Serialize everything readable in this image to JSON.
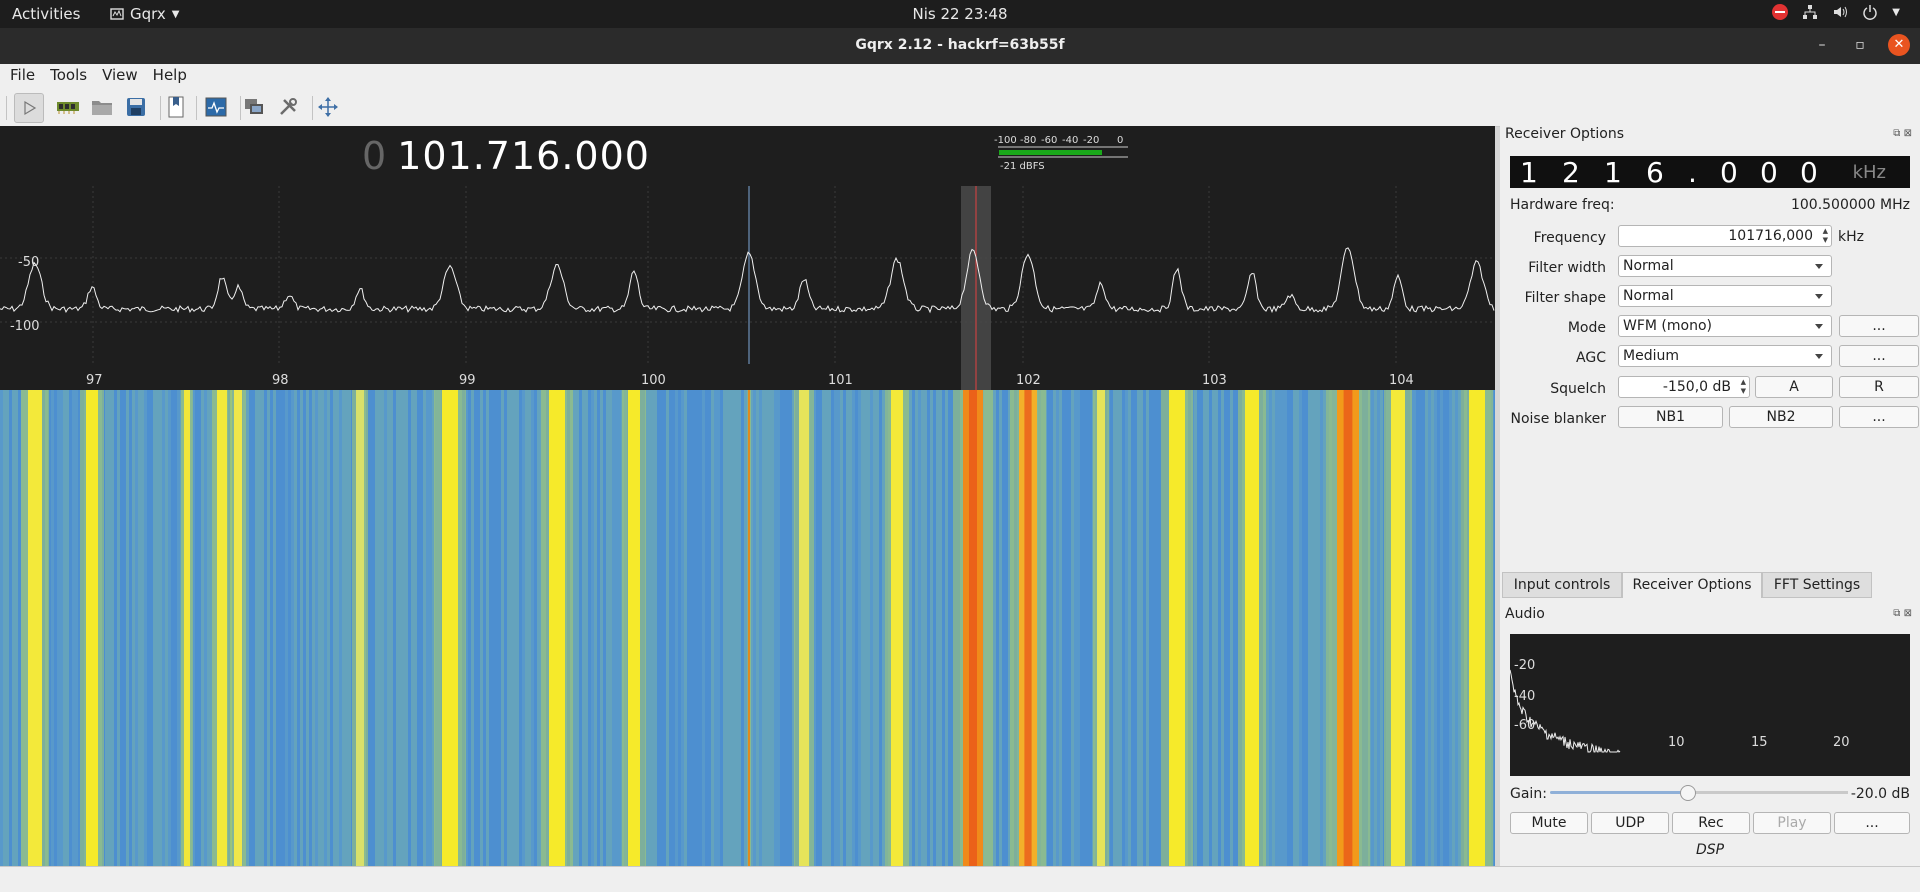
{
  "topbar": {
    "activities": "Activities",
    "app_name": "Gqrx",
    "clock": "Nis 22  23:48"
  },
  "window": {
    "title": "Gqrx 2.12 - hackrf=63b55f"
  },
  "menu": {
    "file": "File",
    "tools": "Tools",
    "view": "View",
    "help": "Help"
  },
  "display": {
    "freq_lead": "0",
    "freq": "101.716.000",
    "meter_scale": [
      "-100",
      "-80",
      "-60",
      "-40",
      "-20",
      "0"
    ],
    "meter_level_label": "-21 dBFS",
    "meter_level_dbfs": -21,
    "y_ticks": [
      "-50",
      "-100"
    ],
    "x_ticks": [
      "97",
      "98",
      "99",
      "100",
      "101",
      "102",
      "103",
      "104"
    ]
  },
  "receiver": {
    "title": "Receiver Options",
    "lcd_digits": [
      "1",
      "2",
      "1",
      "6",
      ".",
      "0",
      "0",
      "0"
    ],
    "lcd_unit": "kHz",
    "hw_label": "Hardware freq:",
    "hw_value": "100.500000 MHz",
    "freq_label": "Frequency",
    "freq_value": "101716,000",
    "freq_unit": "kHz",
    "filter_width_label": "Filter width",
    "filter_width_value": "Normal",
    "filter_shape_label": "Filter shape",
    "filter_shape_value": "Normal",
    "mode_label": "Mode",
    "mode_value": "WFM (mono)",
    "agc_label": "AGC",
    "agc_value": "Medium",
    "squelch_label": "Squelch",
    "squelch_value": "-150,0 dB",
    "squelch_a": "A",
    "squelch_r": "R",
    "nb_label": "Noise blanker",
    "nb1": "NB1",
    "nb2": "NB2",
    "more": "..."
  },
  "tabs": {
    "input": "Input controls",
    "receiver": "Receiver Options",
    "fft": "FFT Settings"
  },
  "audio": {
    "title": "Audio",
    "y_ticks": [
      "-20",
      "-40",
      "-60"
    ],
    "x_ticks": [
      "10",
      "15",
      "20"
    ],
    "gain_label": "Gain:",
    "gain_value": "-20.0 dB",
    "mute": "Mute",
    "udp": "UDP",
    "rec": "Rec",
    "play": "Play",
    "more": "...",
    "dsp": "DSP"
  }
}
